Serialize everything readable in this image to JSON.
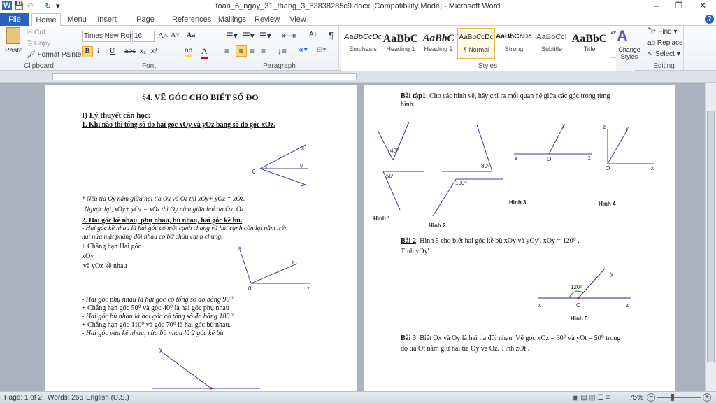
{
  "window": {
    "title": "toan_6_ngay_31_thang_3_83838285c9.docx [Compatibility Mode] - Microsoft Word",
    "minimize": "–",
    "maximize": "❐",
    "close": "✕"
  },
  "quick_access": {
    "app": "W",
    "save": "💾",
    "undo": "↶",
    "redo": "↻",
    "customize": "▾"
  },
  "tabs": [
    "File",
    "Home",
    "Menu",
    "Insert",
    "Page Layout",
    "References",
    "Mailings",
    "Review",
    "View"
  ],
  "help": "?",
  "clipboard": {
    "paste": "Paste",
    "cut": "Cut",
    "copy": "Copy",
    "format_painter": "Format Painter",
    "label": "Clipboard"
  },
  "font": {
    "name": "Times New Rom",
    "size": "16",
    "bold": "B",
    "italic": "I",
    "underline": "U",
    "strike": "abc",
    "sub": "x₂",
    "sup": "x²",
    "grow": "A˄",
    "shrink": "A˅",
    "case": "Aa",
    "color": "A",
    "highlight": "ab",
    "label": "Font"
  },
  "paragraph": {
    "label": "Paragraph",
    "pilcrow": "¶",
    "sort": "A↓"
  },
  "styles": {
    "label": "Styles",
    "items": [
      {
        "preview": "AaBbCcDc",
        "name": "Emphasis"
      },
      {
        "preview": "AaBbC",
        "name": "Heading 1"
      },
      {
        "preview": "AaBbC",
        "name": "Heading 2"
      },
      {
        "preview": "AaBbCcDc",
        "name": "¶ Normal"
      },
      {
        "preview": "AaBbCcDc",
        "name": "Strong"
      },
      {
        "preview": "AaBbCcI",
        "name": "Subtitle"
      },
      {
        "preview": "AaBbC",
        "name": "Title"
      }
    ],
    "change_styles": "Change Styles"
  },
  "editing": {
    "find": "Find",
    "replace": "Replace",
    "select": "Select",
    "label": "Editing"
  },
  "left_page": {
    "title": "§4. VẼ GÓC CHO BIẾT SỐ ĐO",
    "section1": "I) Lý thuyết cần  học:",
    "q1": "1. Khi nào thì tổng số đo hai góc xOy và yOz bằng số đo góc xOz.",
    "fig1": {
      "x": "x",
      "y": "y",
      "z": "z",
      "o": "0"
    },
    "note1": "* Nếu tia Oy nằm giữa hai tia Ox và Oz thì xOy+ yOz = xOz.",
    "note2": "Ngược lại, xOy+ yOz = xOz thì Oy nằm giữa hai tia Ox, Oz.",
    "q2": "2.  Hai góc kề nhau, phụ nhau, bù nhau, hai góc kề bù.",
    "def1a": "-  Hai góc kề nhau là hai góc có một cạnh chung và hai cạnh còn lại nằm trên",
    "def1b": "hai nửa mặt phẳng đối nhau có bờ chứa cạnh chung.",
    "ex1a": "+   Chẳng   hạn   Hai   góc",
    "ex1b": "xOy",
    "ex1c": "và yOz kề nhau",
    "fig2": {
      "x": "x",
      "y": "y",
      "z": "z",
      "o": "0"
    },
    "def2": "-  Hai góc phụ nhau là hai góc có tổng số đo bằng 90⁰",
    "ex2": "+ Chẳng hạn góc 50⁰  và góc 40⁰ là hai góc phụ nhau",
    "def3": "- Hai góc bù nhau là hai góc có tổng số đo bằng 180⁰",
    "ex3": "+ Chẳng hạn góc 110⁰  và góc 70⁰ là hai góc bù nhau.",
    "def4": "- Hai góc vừa kề nhau, vừa bù nhau là 2 góc kề bù.",
    "fig3": {
      "y": "y"
    }
  },
  "right_page": {
    "bt1_label": "Bài tập1",
    "bt1_text": ": Cho các hình vẽ, hãy chỉ ra mối quan hệ giữa các góc trong từng",
    "bt1_text2": "hình.",
    "h1": {
      "a1": "40⁰",
      "a2": "50⁰",
      "caption": "Hình 1"
    },
    "h2": {
      "a1": "80⁰",
      "a2": "100⁰",
      "caption": "Hình 2"
    },
    "h3": {
      "x": "x",
      "o": "O",
      "z": "z",
      "y": "y",
      "caption": "Hình 3"
    },
    "h4": {
      "z": "z",
      "y": "y",
      "o": "O",
      "x": "x",
      "caption": "Hình 4"
    },
    "b2_label": "Bài 2",
    "b2_text": ":  Hình 5 cho biết hai góc kề bù xOy và yOy′, xOy = 120⁰ .",
    "b2_text2": "Tính yOy′",
    "h5": {
      "angle": "120⁰",
      "x": "x",
      "o": "O",
      "z": "z",
      "y": "y",
      "caption": "Hình 5"
    },
    "b3_label": "Bài 3",
    "b3_text": ": Biết Ox và Oy là hai tia đối nhau. Vẽ góc xOz = 30⁰ và yOt  = 50⁰ trong",
    "b3_text2": "đó tia Ot nằm giữ hai tia Oy và Oz. Tính zOt ."
  },
  "status": {
    "page": "Page: 1 of 2",
    "words": "Words: 266",
    "language": "English (U.S.)",
    "zoom": "75%",
    "zoom_level": 75
  }
}
